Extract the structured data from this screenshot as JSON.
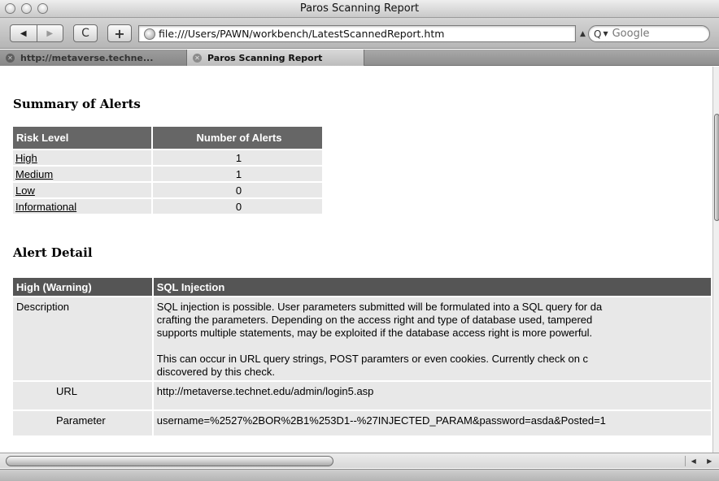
{
  "window": {
    "title": "Paros Scanning Report"
  },
  "toolbar": {
    "back_icon": "back-arrow",
    "forward_icon": "forward-arrow",
    "reload_label": "C",
    "new_tab_label": "+",
    "url": "file:///Users/PAWN/workbench/LatestScannedReport.htm",
    "search_placeholder": "Google"
  },
  "tabs": [
    {
      "label": "http://metaverse.techne...",
      "active": false
    },
    {
      "label": "Paros Scanning Report",
      "active": true
    }
  ],
  "summary": {
    "title": "Summary of Alerts",
    "headers": [
      "Risk Level",
      "Number of Alerts"
    ],
    "rows": [
      {
        "level": "High",
        "count": "1"
      },
      {
        "level": "Medium",
        "count": "1"
      },
      {
        "level": "Low",
        "count": "0"
      },
      {
        "level": "Informational",
        "count": "0"
      }
    ]
  },
  "detail": {
    "title": "Alert Detail",
    "header_risk": "High (Warning)",
    "header_name": "SQL Injection",
    "description_label": "Description",
    "description_p1_lines": [
      "SQL injection is possible. User parameters submitted will be formulated into a SQL query for da",
      "crafting the parameters. Depending on the access right and type of database used, tampered",
      "supports multiple statements, may be exploited if the database access right is more powerful."
    ],
    "description_p2_lines": [
      "This can occur in URL query strings, POST paramters or even cookies. Currently check on c",
      "discovered by this check."
    ],
    "url_label": "URL",
    "url_value": "http://metaverse.technet.edu/admin/login5.asp",
    "parameter_label": "Parameter",
    "parameter_value": "username=%2527%2BOR%2B1%253D1--%27INJECTED_PARAM&password=asda&Posted=1"
  }
}
